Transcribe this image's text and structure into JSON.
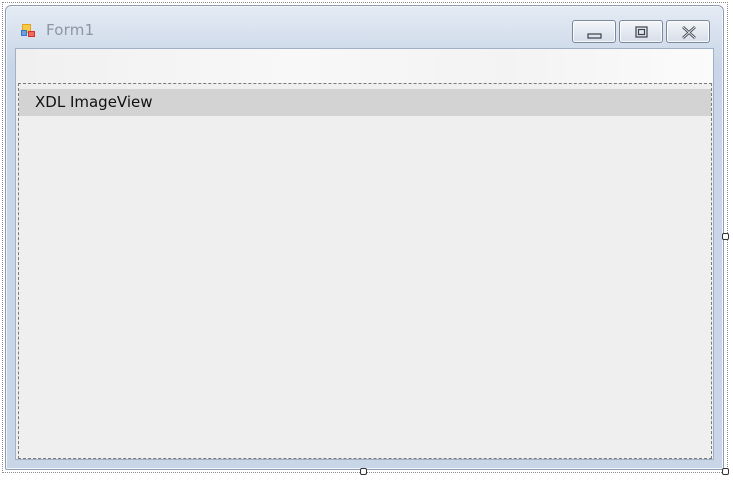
{
  "window": {
    "title": "Form1",
    "icon": "windows-forms-icon"
  },
  "caption_buttons": {
    "minimize_icon": "minimize-icon",
    "maximize_icon": "maximize-icon",
    "close_icon": "close-icon"
  },
  "control": {
    "item_text": "XDL ImageView"
  },
  "colors": {
    "title_text": "#8d96a3",
    "client_background": "#efefef",
    "item_highlight": "#d3d3d3",
    "frame_border": "#8e9db3"
  }
}
